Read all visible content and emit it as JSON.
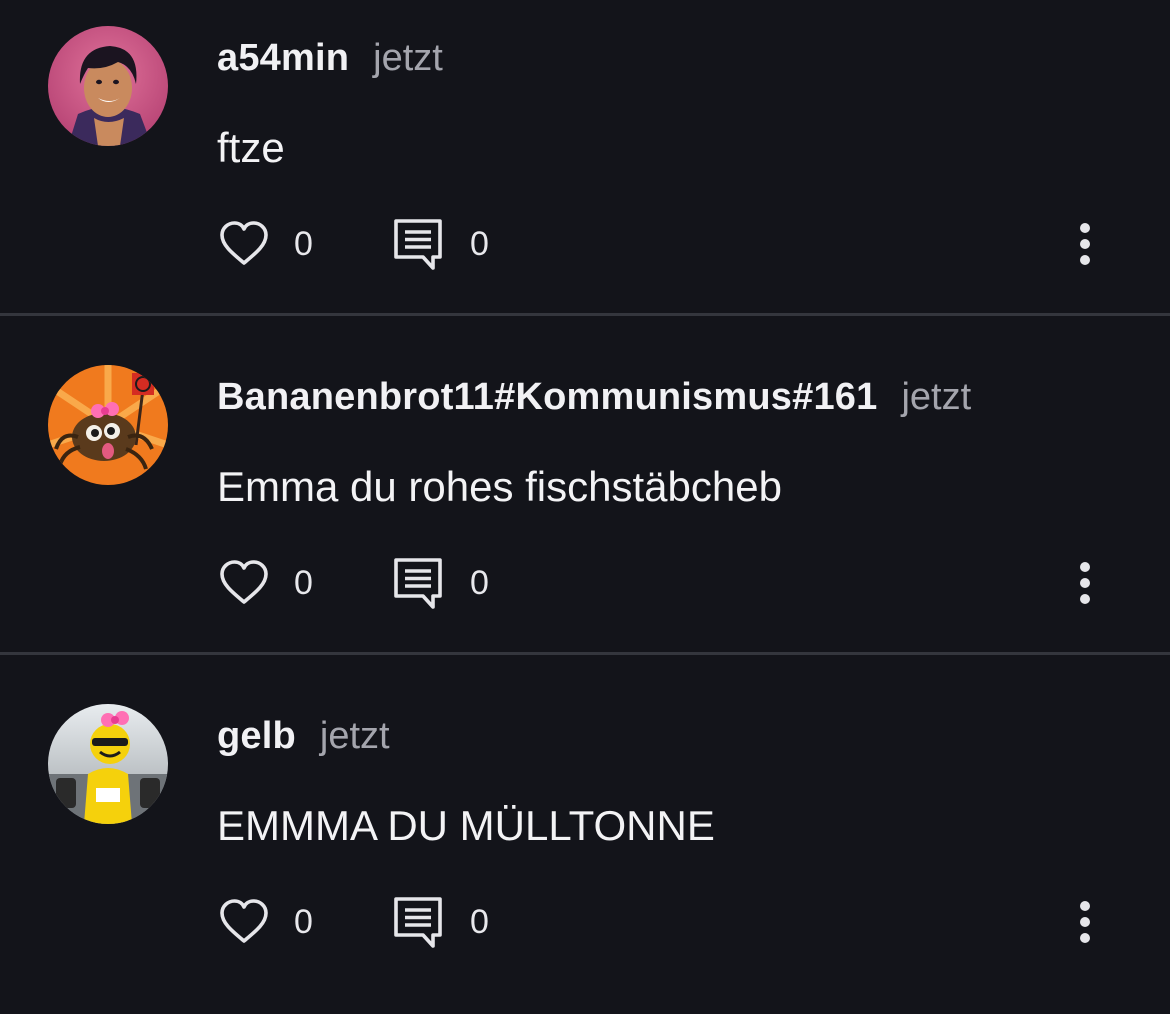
{
  "colors": {
    "background": "#13141a",
    "divider": "#34363d",
    "text": "#f2f2f4",
    "muted": "#a4a5ad",
    "icon": "#e6e6ea"
  },
  "posts": [
    {
      "username": "a54min",
      "time": "jetzt",
      "text": "ftze",
      "likes": "0",
      "comments": "0",
      "avatar": "aladdin-avatar"
    },
    {
      "username": "Bananenbrot11#Kommunismus#161",
      "time": "jetzt",
      "text": "Emma du rohes fischstäbcheb",
      "likes": "0",
      "comments": "0",
      "avatar": "spider-avatar"
    },
    {
      "username": "gelb",
      "time": "jetzt",
      "text": "EMMMA DU MÜLLTONNE",
      "likes": "0",
      "comments": "0",
      "avatar": "race-car-avatar"
    }
  ],
  "icons": {
    "like": "heart-icon",
    "comment": "comment-icon",
    "more": "more-vertical-icon"
  }
}
